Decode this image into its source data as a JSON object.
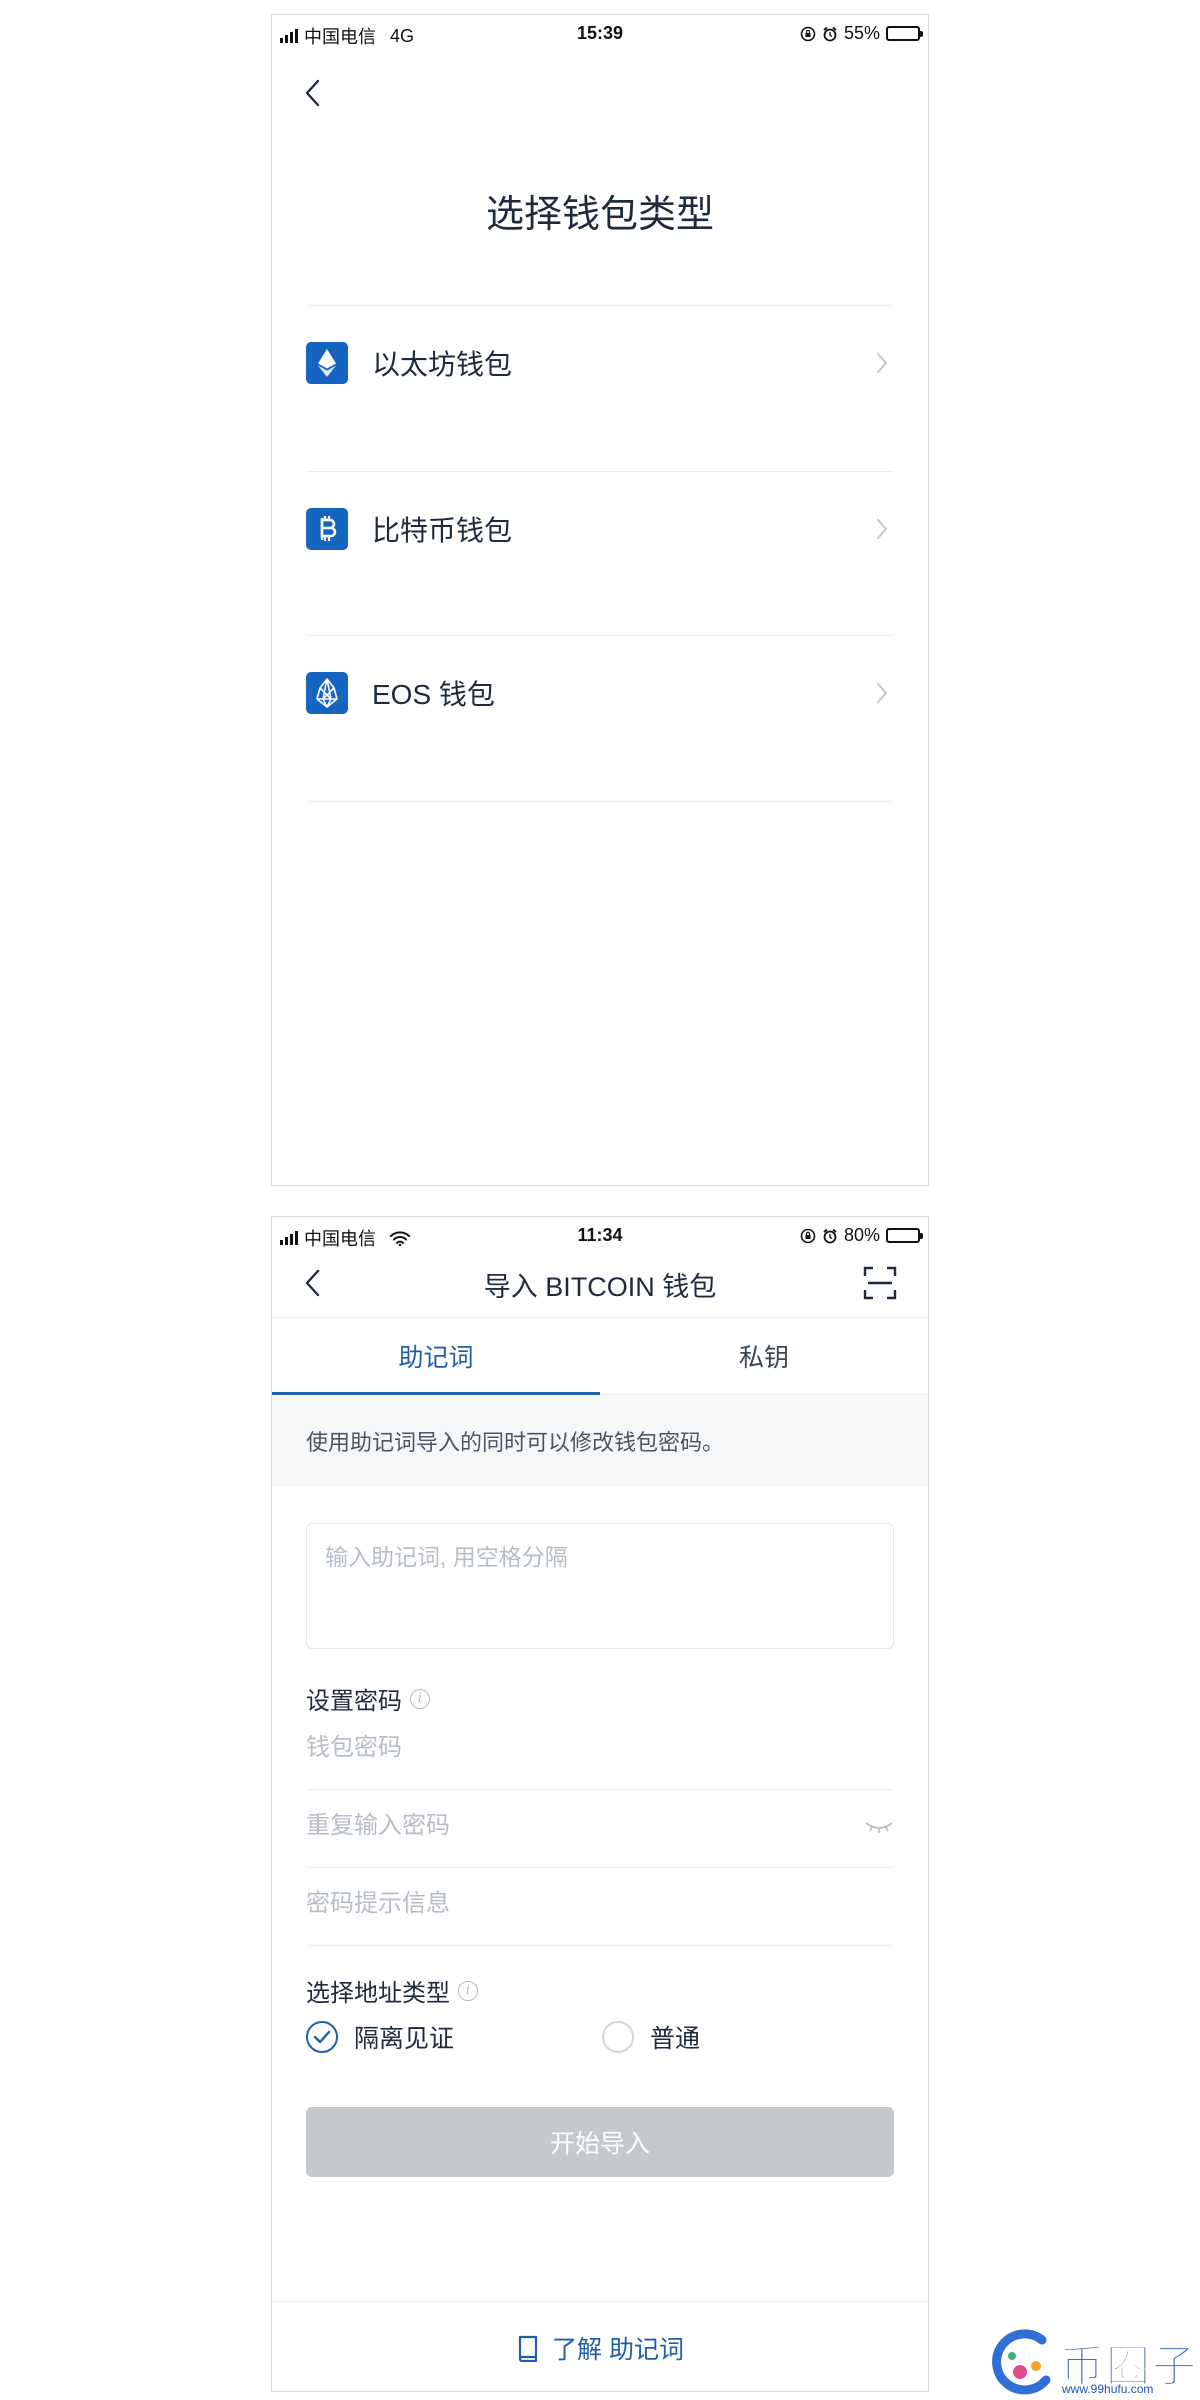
{
  "screen1": {
    "status_bar": {
      "carrier": "中国电信",
      "network": "4G",
      "time": "15:39",
      "battery": "55%",
      "battery_level": 0.55
    },
    "title": "选择钱包类型",
    "wallets": [
      {
        "label": "以太坊钱包",
        "icon": "ethereum-icon"
      },
      {
        "label": "比特币钱包",
        "icon": "bitcoin-icon"
      },
      {
        "label": "EOS 钱包",
        "icon": "eos-icon"
      }
    ]
  },
  "screen2": {
    "status_bar": {
      "carrier": "中国电信",
      "network": "wifi-icon",
      "time": "11:34",
      "battery": "80%",
      "battery_level": 0.8
    },
    "title": "导入 BITCOIN 钱包",
    "tabs": [
      {
        "label": "助记词",
        "active": true
      },
      {
        "label": "私钥",
        "active": false
      }
    ],
    "notice": "使用助记词导入的同时可以修改钱包密码。",
    "mnemonic_placeholder": "输入助记词, 用空格分隔",
    "password_section_label": "设置密码",
    "password_placeholder": "钱包密码",
    "repeat_password_placeholder": "重复输入密码",
    "hint_placeholder": "密码提示信息",
    "address_type_label": "选择地址类型",
    "address_types": [
      {
        "label": "隔离见证",
        "selected": true
      },
      {
        "label": "普通",
        "selected": false
      }
    ],
    "start_button": "开始导入",
    "footer_link": "了解 助记词"
  },
  "watermark": {
    "title": "币圈子",
    "url": "www.99hufu.com"
  },
  "colors": {
    "accent": "#1f5fa8",
    "wallet_icon_bg": "#1565c0",
    "disabled_button": "#c5c9cd"
  }
}
